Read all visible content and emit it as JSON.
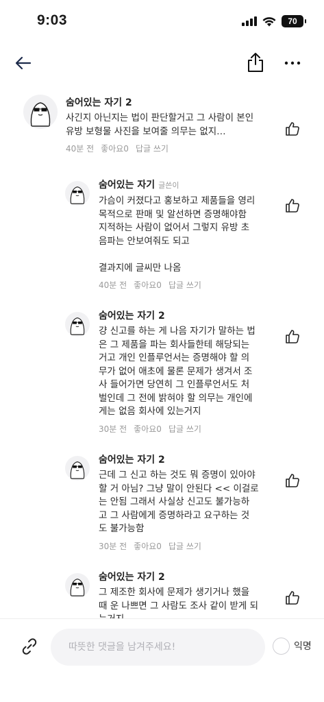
{
  "status_bar": {
    "time": "9:03",
    "battery": "70"
  },
  "nav": {
    "back_icon": "arrow-left-icon",
    "share_icon": "share-icon",
    "more_icon": "more-dots-icon"
  },
  "comments": [
    {
      "author": "숨어있는 자기 2",
      "writer_badge": "",
      "text": "사긴지 아닌지는 법이 판단할거고 그 사람이 본인\n유방 보형물 사진을 보여줄 의무는 없지…",
      "time": "40분 전",
      "likes": "좋아요0",
      "reply": "답글 쓰기"
    },
    {
      "author": "숨어있는 자기",
      "writer_badge": "글쓴이",
      "text": "가슴이 커졌다고 홍보하고 제품들을 영리\n목적으로 판매 및 알선하면 증명해야함\n지적하는 사람이 없어서 그렇지 유방 초\n음파는 안보여줘도 되고\n\n결과지에 글씨만 나옴",
      "time": "40분 전",
      "likes": "좋아요0",
      "reply": "답글 쓰기"
    },
    {
      "author": "숨어있는 자기 2",
      "writer_badge": "",
      "text": "걍 신고를 하는 게 나음 자기가 말하는 법\n은 그 제품을 파는 회사들한테 해당되는\n거고 개인 인플루언서는 증명해야 할 의\n무가 없어 애초에 물론 문제가 생겨서 조\n사 들어가면 당연히 그 인플루언서도 처\n벌인데 그 전에 밝혀야 할 의무는 개인에\n게는 없음 회사에 있는거지",
      "time": "30분 전",
      "likes": "좋아요0",
      "reply": "답글 쓰기"
    },
    {
      "author": "숨어있는 자기 2",
      "writer_badge": "",
      "text": "근데 그 신고 하는 것도 뭐 증명이 있아야\n할 거 아님? 그냥 말이 안된다 << 이걸로\n는 안됨 그래서 사실상 신고도 불가능하\n고 그 사람에게 증명하라고 요구하는 것\n도 불가능함",
      "time": "30분 전",
      "likes": "좋아요0",
      "reply": "답글 쓰기"
    },
    {
      "author": "숨어있는 자기 2",
      "writer_badge": "",
      "text": "그 제조한 회사에 문제가 생기거나 했을\n때 운 나쁘면 그 사람도 조사 같이 받게 되\n는거지",
      "time": "",
      "likes": "",
      "reply": ""
    }
  ],
  "input": {
    "placeholder": "따뜻한 댓글을 남겨주세요!",
    "value": "",
    "anonymous_label": "익명"
  }
}
